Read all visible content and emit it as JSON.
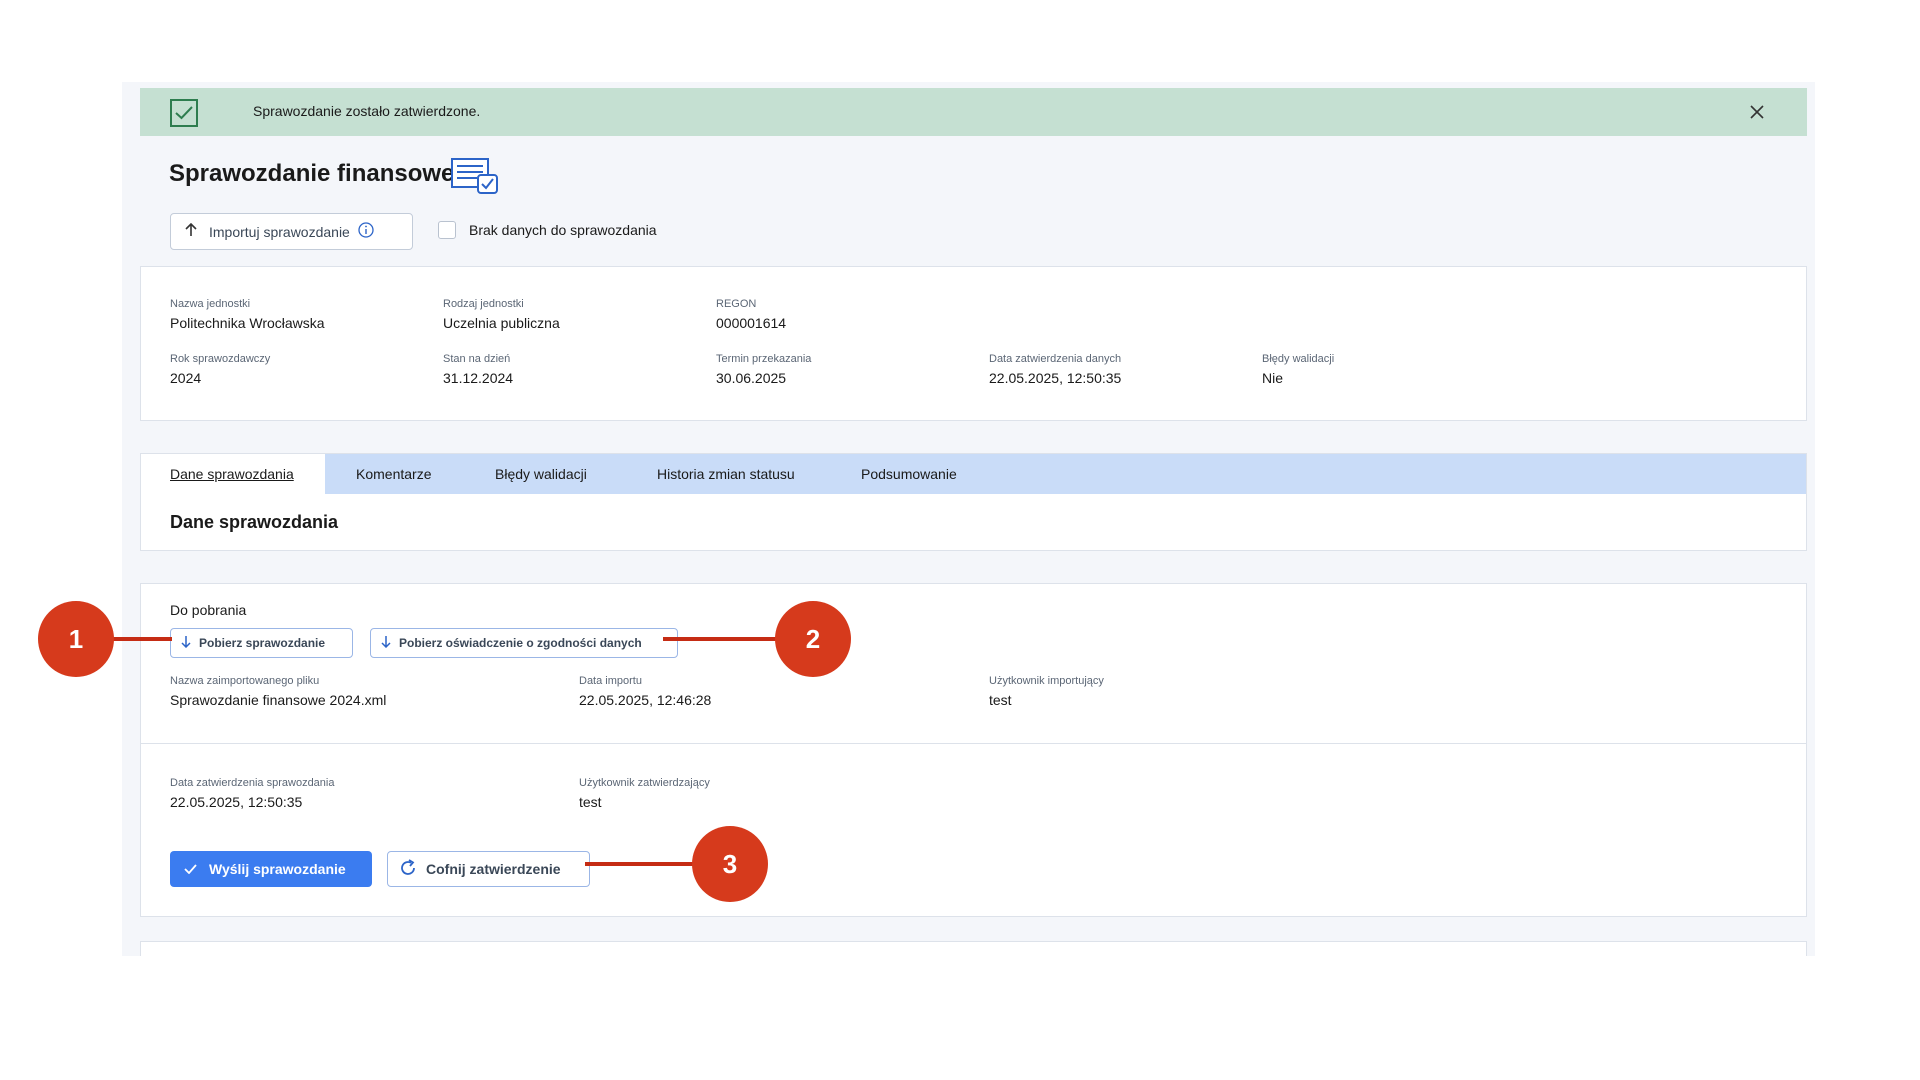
{
  "banner": {
    "message": "Sprawozdanie zostało zatwierdzone.",
    "status_color": "#c5e0d2"
  },
  "page": {
    "title": "Sprawozdanie finansowe",
    "title_icon": "report-check-icon"
  },
  "toolbar": {
    "import_label": "Importuj sprawozdanie",
    "no_data_label": "Brak danych do sprawozdania",
    "no_data_checked": false
  },
  "info": {
    "nazwa_jednostki": {
      "label": "Nazwa jednostki",
      "value": "Politechnika Wrocławska"
    },
    "rodzaj_jednostki": {
      "label": "Rodzaj jednostki",
      "value": "Uczelnia publiczna"
    },
    "regon": {
      "label": "REGON",
      "value": "000001614"
    },
    "rok": {
      "label": "Rok sprawozdawczy",
      "value": "2024"
    },
    "stan_na_dzien": {
      "label": "Stan na dzień",
      "value": "31.12.2024"
    },
    "termin": {
      "label": "Termin przekazania",
      "value": "30.06.2025"
    },
    "data_zatw_danych": {
      "label": "Data zatwierdzenia danych",
      "value": "22.05.2025, 12:50:35"
    },
    "bledy": {
      "label": "Błędy walidacji",
      "value": "Nie"
    }
  },
  "tabs": [
    {
      "label": "Dane sprawozdania",
      "active": true
    },
    {
      "label": "Komentarze",
      "active": false
    },
    {
      "label": "Błędy walidacji",
      "active": false
    },
    {
      "label": "Historia zmian statusu",
      "active": false
    },
    {
      "label": "Podsumowanie",
      "active": false
    }
  ],
  "section_title": "Dane sprawozdania",
  "downloads": {
    "title": "Do pobrania",
    "btn_report": "Pobierz sprawozdanie",
    "btn_statement": "Pobierz oświadczenie o zgodności danych",
    "file_name": {
      "label": "Nazwa zaimportowanego pliku",
      "value": "Sprawozdanie finansowe 2024.xml"
    },
    "import_date": {
      "label": "Data importu",
      "value": "22.05.2025, 12:46:28"
    },
    "import_user": {
      "label": "Użytkownik importujący",
      "value": "test"
    },
    "approve_date": {
      "label": "Data zatwierdzenia sprawozdania",
      "value": "22.05.2025, 12:50:35"
    },
    "approve_user": {
      "label": "Użytkownik zatwierdzający",
      "value": "test"
    },
    "send_label": "Wyślij sprawozdanie",
    "undo_label": "Cofnij zatwierdzenie"
  },
  "callouts": [
    "1",
    "2",
    "3"
  ],
  "colors": {
    "accent": "#3b7cf0",
    "tabbar": "#c9dcf8",
    "callout": "#d63a1c"
  }
}
